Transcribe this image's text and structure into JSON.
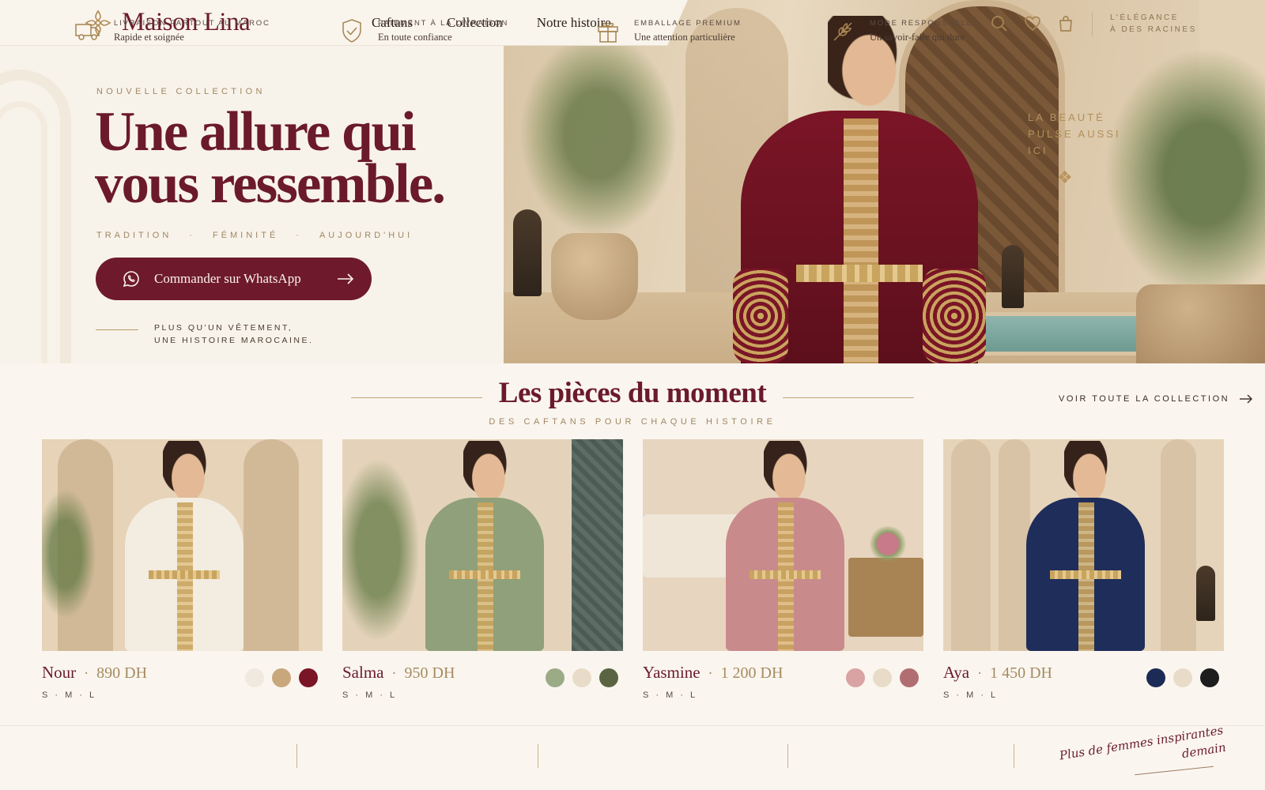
{
  "brand": {
    "name": "Maison Lina"
  },
  "nav": {
    "items": [
      "Caftans",
      "Collection",
      "Notre histoire"
    ]
  },
  "header": {
    "icons": [
      "search-icon",
      "heart-icon",
      "bag-icon"
    ],
    "tagline_line1": "L'ÉLÉGANCE",
    "tagline_line2": "À DES RACINES"
  },
  "hero": {
    "eyebrow": "NOUVELLE COLLECTION",
    "title_line1": "Une allure qui",
    "title_line2": "vous ressemble.",
    "subtitle": [
      "TRADITION",
      "·",
      "FÉMINITÉ",
      "·",
      "AUJOURD'HUI"
    ],
    "cta_label": "Commander sur WhatsApp",
    "note_line1": "PLUS QU'UN VÊTEMENT,",
    "note_line2": "UNE HISTOIRE MAROCAINE.",
    "image_caption": [
      "LA BEAUTÉ",
      "PULSE AUSSI",
      "ICI"
    ]
  },
  "section": {
    "title": "Les pièces du moment",
    "subtitle": "DES CAFTANS POUR CHAQUE HISTOIRE",
    "see_all": "VOIR TOUTE LA COLLECTION"
  },
  "products": [
    {
      "name": "Nour",
      "price": "890 DH",
      "sizes": "S · M · L",
      "dress_color": "#f3ece0",
      "bg_color": "#e6d3b8",
      "swatches": [
        "#efe9df",
        "#c9a77c",
        "#7a1526"
      ]
    },
    {
      "name": "Salma",
      "price": "950 DH",
      "sizes": "S · M · L",
      "dress_color": "#8fa07a",
      "bg_color": "#e4d3ba",
      "swatches": [
        "#9aab86",
        "#e8dcc8",
        "#5a6442"
      ]
    },
    {
      "name": "Yasmine",
      "price": "1 200 DH",
      "sizes": "S · M · L",
      "dress_color": "#c98a8c",
      "bg_color": "#e8d5bf",
      "swatches": [
        "#d9a2a3",
        "#e8dcc8",
        "#b06e72"
      ]
    },
    {
      "name": "Aya",
      "price": "1 450 DH",
      "sizes": "S · M · L",
      "dress_color": "#1f2d5a",
      "bg_color": "#e6d4ba",
      "swatches": [
        "#1c2a56",
        "#e8dcc8",
        "#1d1d1d"
      ]
    }
  ],
  "features": [
    {
      "icon": "truck-icon",
      "title": "LIVRAISON PARTOUT AU MAROC",
      "desc": "Rapide et soignée"
    },
    {
      "icon": "shield-check-icon",
      "title": "PAIEMENT À LA LIVRAISON",
      "desc": "En toute confiance"
    },
    {
      "icon": "gift-icon",
      "title": "EMBALLAGE PREMIUM",
      "desc": "Une attention particulière"
    },
    {
      "icon": "leaf-icon",
      "title": "MODE RESPONSABLE",
      "desc": "Un savoir-faire qui dure"
    }
  ],
  "signature": {
    "line1": "Plus de femmes inspirantes",
    "line2": "demain"
  },
  "colors": {
    "burgundy": "#6e1a2c",
    "gold": "#b7996a",
    "cream": "#faf6ef"
  }
}
